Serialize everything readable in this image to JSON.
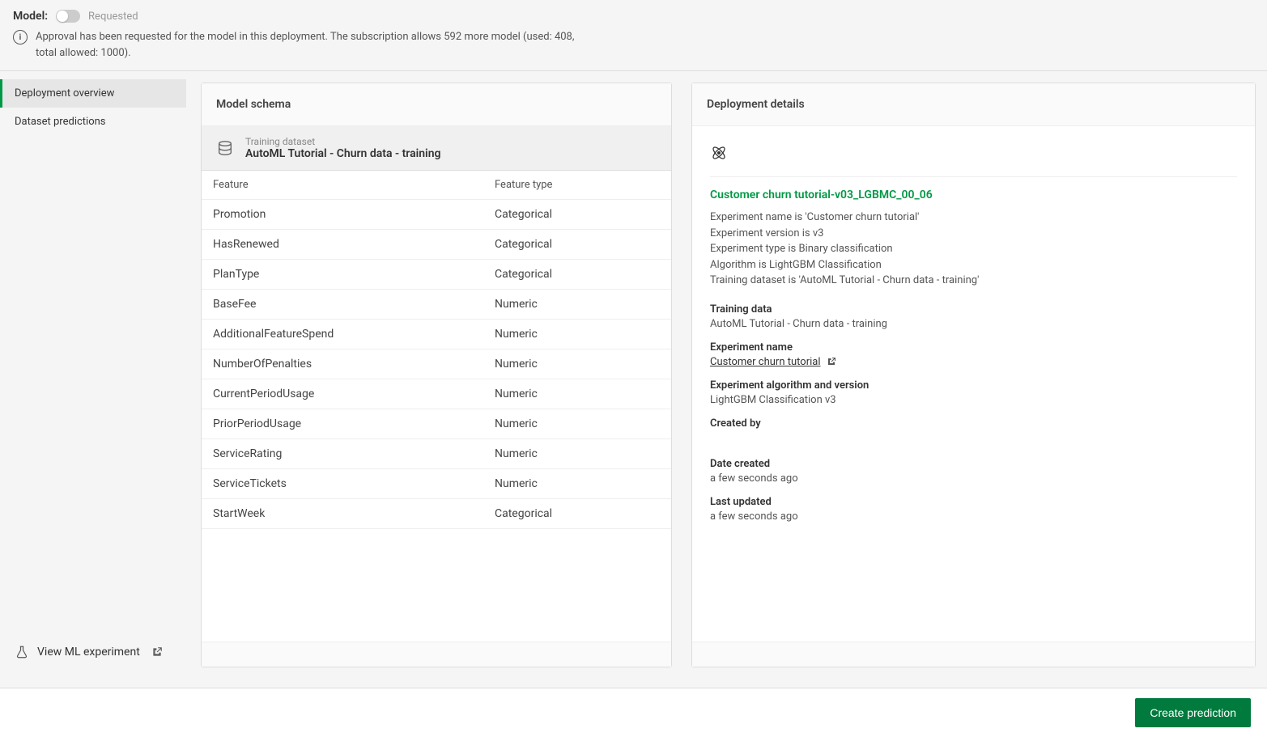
{
  "topbar": {
    "model_label": "Model:",
    "status": "Requested",
    "info": "Approval has been requested for the model in this deployment. The subscription allows 592 more model (used: 408, total allowed: 1000)."
  },
  "sidebar": {
    "items": [
      {
        "label": "Deployment overview",
        "active": true
      },
      {
        "label": "Dataset predictions",
        "active": false
      }
    ],
    "view_experiment": "View ML experiment"
  },
  "schema": {
    "title": "Model schema",
    "dataset_label": "Training dataset",
    "dataset_name": "AutoML Tutorial - Churn data - training",
    "columns": [
      "Feature",
      "Feature type"
    ],
    "rows": [
      {
        "feature": "Promotion",
        "type": "Categorical"
      },
      {
        "feature": "HasRenewed",
        "type": "Categorical"
      },
      {
        "feature": "PlanType",
        "type": "Categorical"
      },
      {
        "feature": "BaseFee",
        "type": "Numeric"
      },
      {
        "feature": "AdditionalFeatureSpend",
        "type": "Numeric"
      },
      {
        "feature": "NumberOfPenalties",
        "type": "Numeric"
      },
      {
        "feature": "CurrentPeriodUsage",
        "type": "Numeric"
      },
      {
        "feature": "PriorPeriodUsage",
        "type": "Numeric"
      },
      {
        "feature": "ServiceRating",
        "type": "Numeric"
      },
      {
        "feature": "ServiceTickets",
        "type": "Numeric"
      },
      {
        "feature": "StartWeek",
        "type": "Categorical"
      }
    ]
  },
  "details": {
    "title": "Deployment details",
    "exp_title": "Customer churn tutorial-v03_LGBMC_00_06",
    "desc_lines": [
      "Experiment name is 'Customer churn tutorial'",
      "Experiment version is v3",
      "Experiment type is Binary classification",
      "Algorithm is LightGBM Classification",
      "Training dataset is 'AutoML Tutorial - Churn data - training'"
    ],
    "training_data_label": "Training data",
    "training_data_val": "AutoML Tutorial - Churn data - training",
    "exp_name_label": "Experiment name",
    "exp_name_val": "Customer churn tutorial",
    "algo_label": "Experiment algorithm and version",
    "algo_val": "LightGBM Classification v3",
    "created_by_label": "Created by",
    "created_by_val": "",
    "date_created_label": "Date created",
    "date_created_val": "a few seconds ago",
    "last_updated_label": "Last updated",
    "last_updated_val": "a few seconds ago"
  },
  "footer": {
    "create_btn": "Create prediction"
  }
}
